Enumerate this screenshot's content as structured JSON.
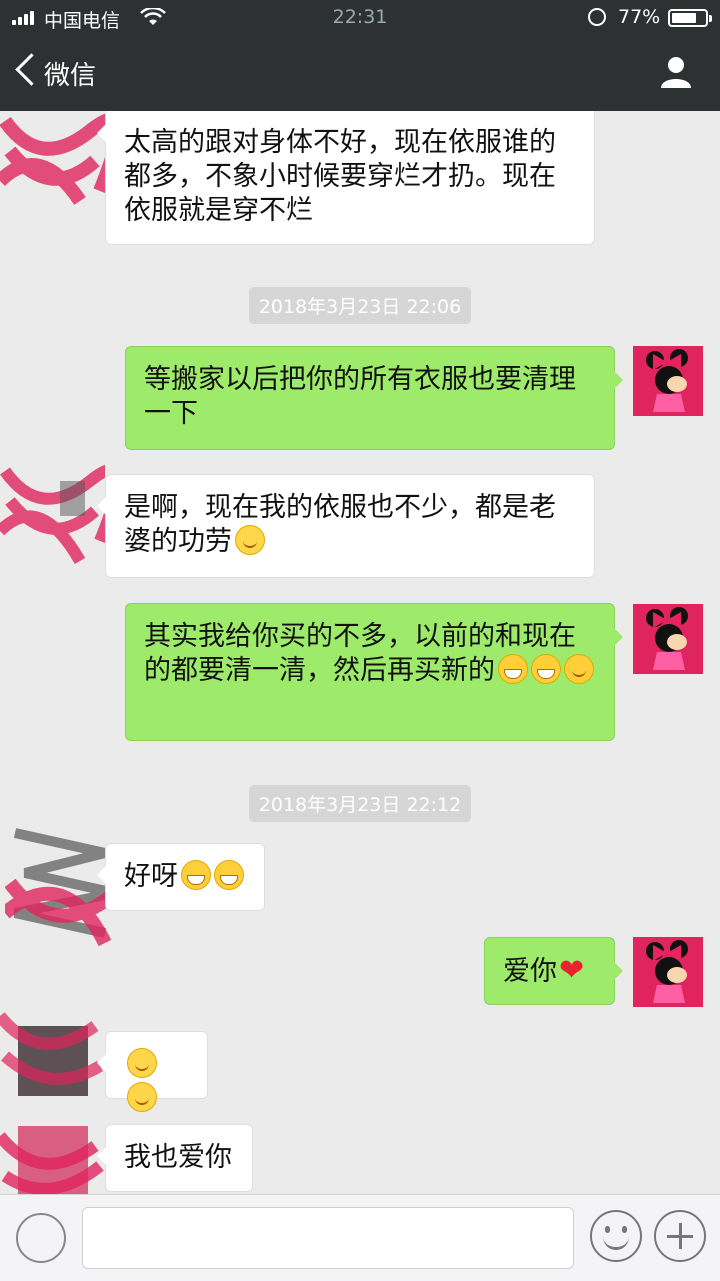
{
  "status_bar": {
    "carrier": "中国电信",
    "time": "22:31",
    "battery": "77%"
  },
  "header": {
    "back_label": "微信",
    "title": ""
  },
  "messages": [
    {
      "from": "them",
      "text": "太高的跟对身体不好，现在依服谁的都多，不象小时候要穿烂才扔。现在依服就是穿不烂"
    },
    {
      "type": "timestamp",
      "text": "2018年3月23日 22:06"
    },
    {
      "from": "me",
      "text": "等搬家以后把你的所有衣服也要清理一下"
    },
    {
      "from": "them",
      "text": "是啊，现在我的依服也不少，都是老婆的功劳",
      "emojis": [
        "smile-emoji"
      ]
    },
    {
      "from": "me",
      "text": "其实我给你买的不多，以前的和现在的都要清一清，然后再买新的",
      "emojis": [
        "grin-emoji",
        "grin-emoji",
        "surprised-emoji"
      ]
    },
    {
      "type": "timestamp",
      "text": "2018年3月23日 22:12"
    },
    {
      "from": "them",
      "text": "好呀",
      "emojis": [
        "grin-emoji",
        "grin-emoji"
      ]
    },
    {
      "from": "me",
      "text": "爱你",
      "emojis": [
        "heart-emoji"
      ]
    },
    {
      "from": "them",
      "text": "",
      "emojis": [
        "kiss-emoji",
        "kiss-emoji"
      ]
    },
    {
      "from": "them",
      "text": "我也爱你"
    }
  ],
  "colors": {
    "outgoing_bubble": "#9eea6a",
    "incoming_bubble": "#ffffff",
    "background": "#ebebeb",
    "header": "#2e3132"
  }
}
